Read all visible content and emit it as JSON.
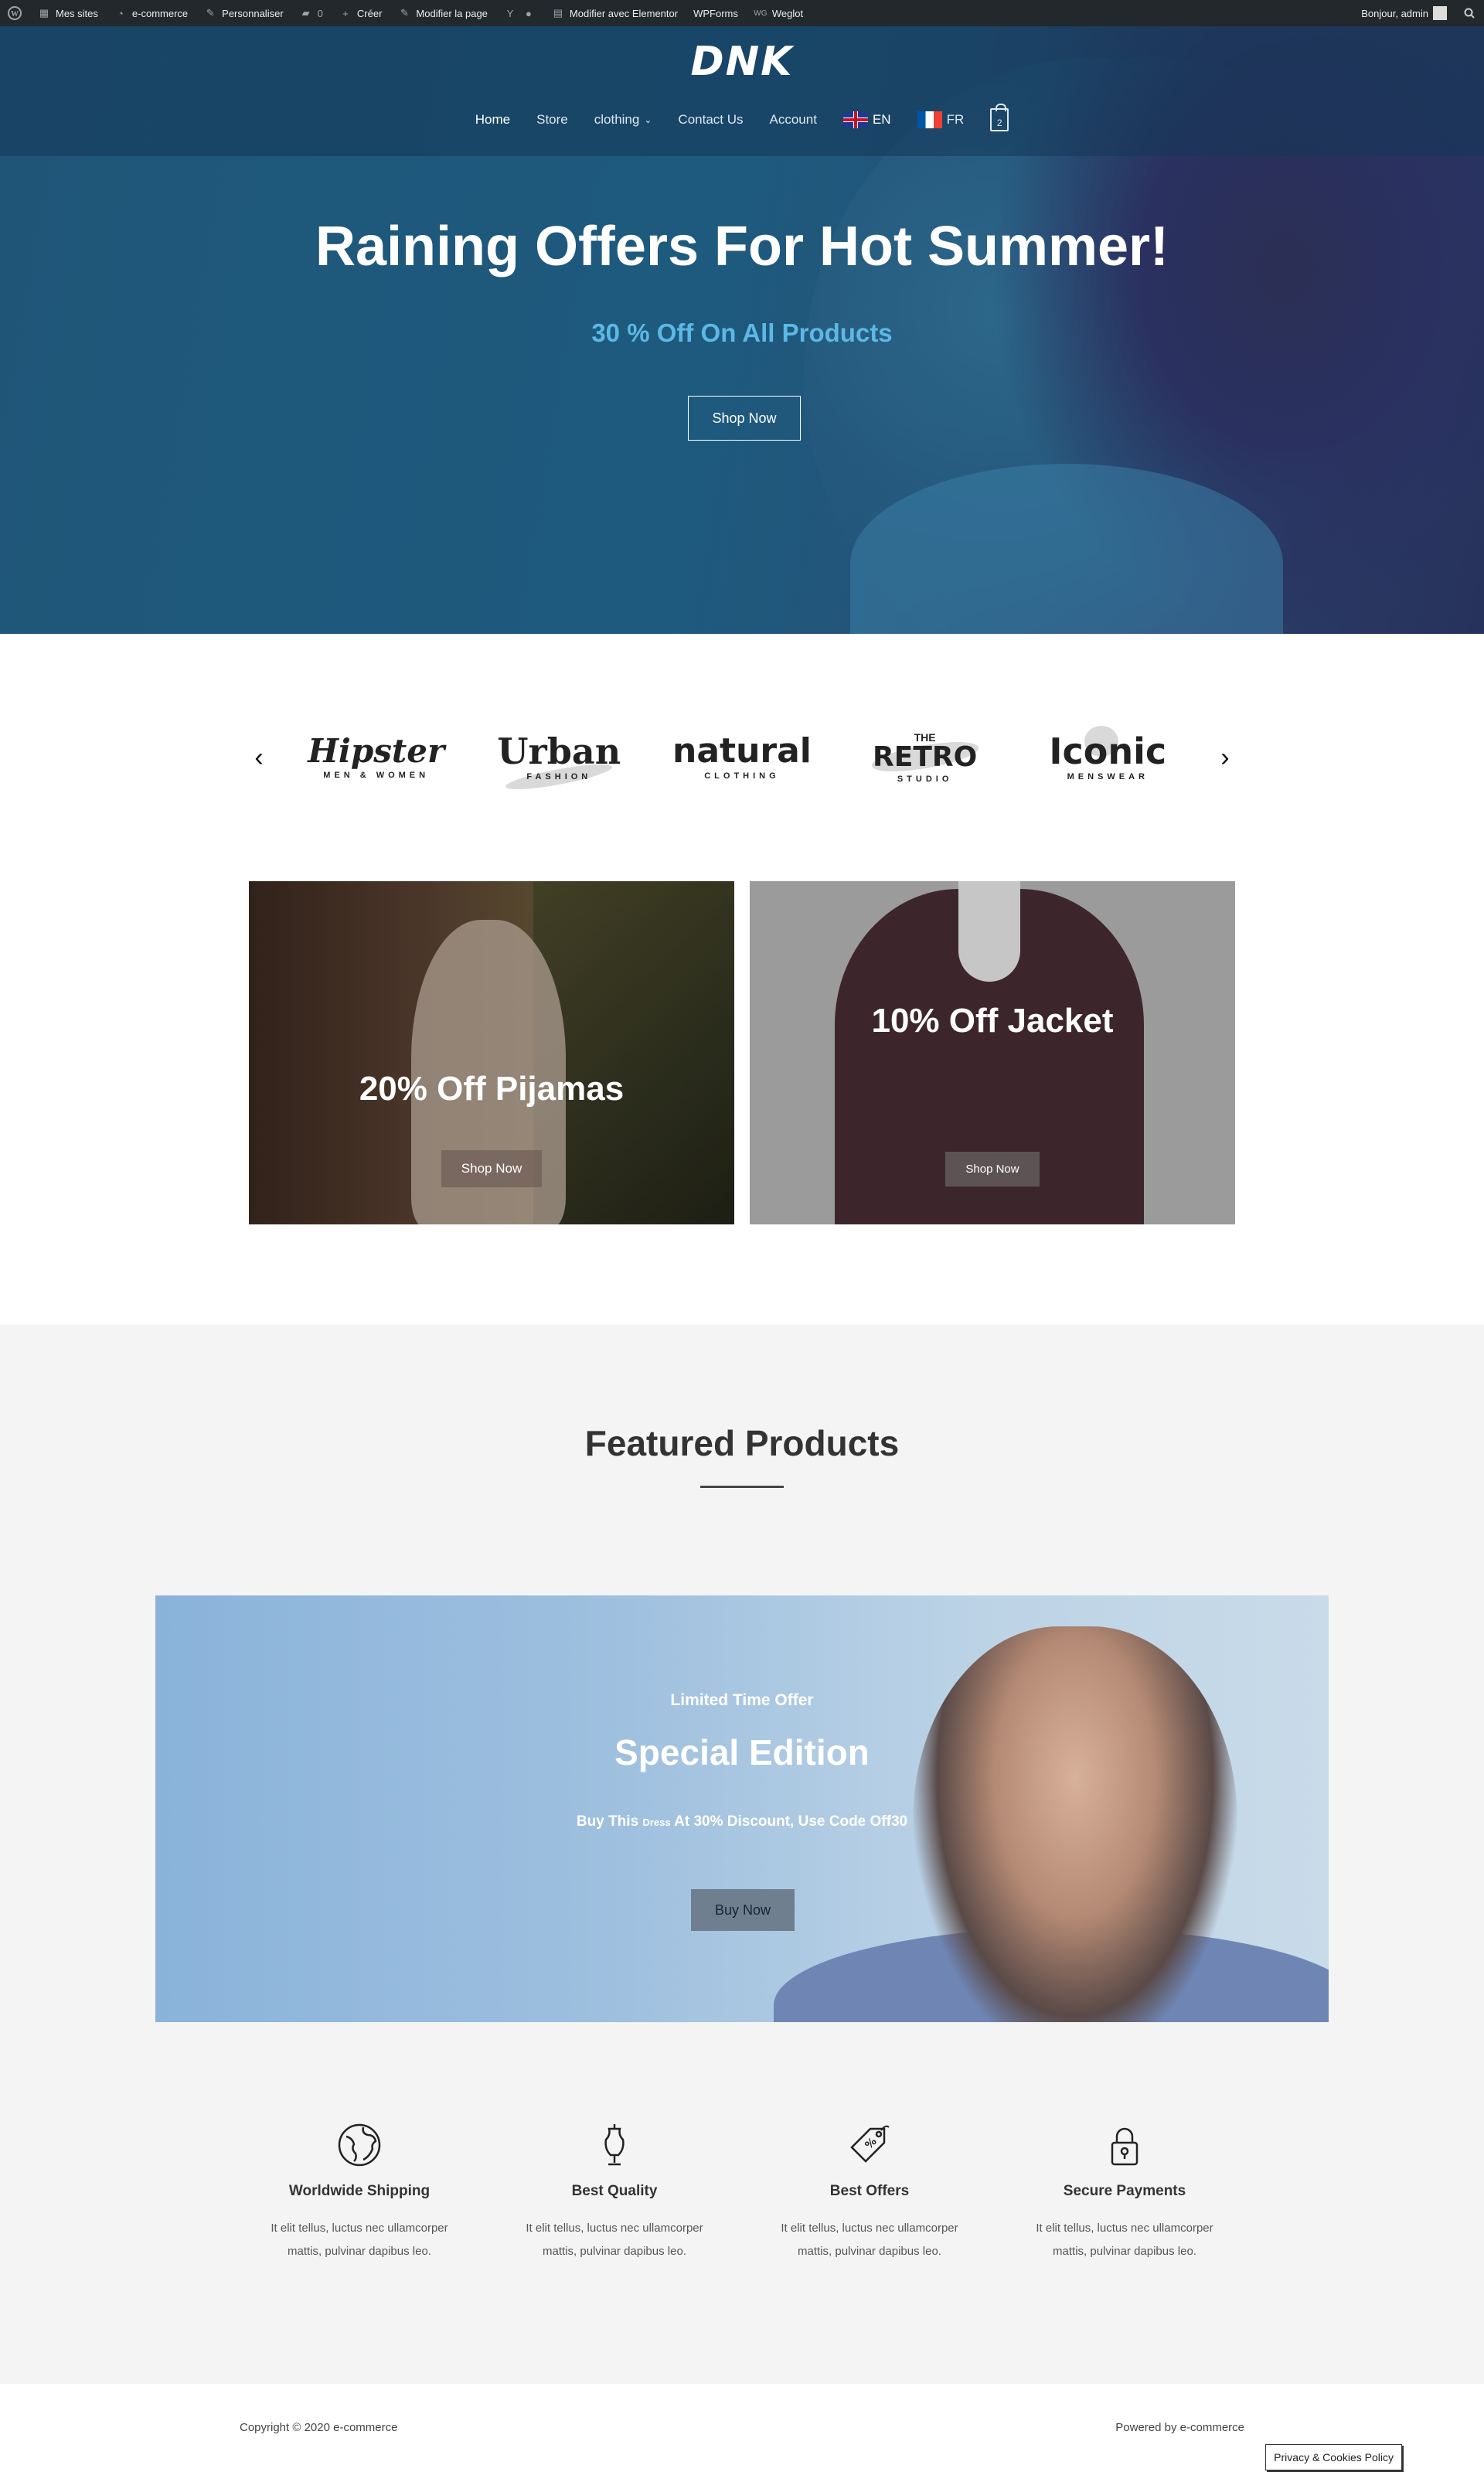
{
  "adminbar": {
    "my_sites": "Mes sites",
    "site_name": "e-commerce",
    "customize": "Personnaliser",
    "comments_count": "0",
    "new": "Créer",
    "edit_page": "Modifier la page",
    "edit_elementor": "Modifier avec Elementor",
    "wpforms": "WPForms",
    "weglot": "Weglot",
    "greeting": "Bonjour, admin"
  },
  "header": {
    "logo": "DNK",
    "nav": [
      "Home",
      "Store",
      "clothing",
      "Contact Us",
      "Account"
    ],
    "lang_en": "EN",
    "lang_fr": "FR",
    "cart_count": "2"
  },
  "hero": {
    "title": "Raining Offers For Hot Summer!",
    "subtitle": "30 % Off On All Products",
    "button": "Shop Now"
  },
  "brands": [
    {
      "name": "Hipster",
      "tag": "MEN & WOMEN"
    },
    {
      "name": "Urban",
      "tag": "FASHION"
    },
    {
      "name": "natural",
      "tag": "CLOTHING"
    },
    {
      "the": "THE",
      "name": "RETRO",
      "tag": "STUDIO"
    },
    {
      "name": "Iconic",
      "tag": "MENSWEAR"
    }
  ],
  "promos": [
    {
      "title": "20% Off Pijamas",
      "button": "Shop Now"
    },
    {
      "title": "10% Off Jacket",
      "button": "Shop Now"
    }
  ],
  "featured": {
    "title": "Featured Products"
  },
  "banner": {
    "small": "Limited Time Offer",
    "title": "Special Edition",
    "desc_before": "Buy This",
    "desc_dress": "Dress",
    "desc_after": "At 30% Discount, Use Code Off30",
    "button": "Buy Now"
  },
  "features": [
    {
      "title": "Worldwide Shipping",
      "text": "It elit tellus, luctus nec ullamcorper mattis, pulvinar dapibus leo.",
      "icon": "globe-icon"
    },
    {
      "title": "Best Quality",
      "text": "It elit tellus, luctus nec ullamcorper mattis, pulvinar dapibus leo.",
      "icon": "mannequin-icon"
    },
    {
      "title": "Best Offers",
      "text": "It elit tellus, luctus nec ullamcorper mattis, pulvinar dapibus leo.",
      "icon": "price-tag-icon"
    },
    {
      "title": "Secure Payments",
      "text": "It elit tellus, luctus nec ullamcorper mattis, pulvinar dapibus leo.",
      "icon": "lock-icon"
    }
  ],
  "footer": {
    "copyright": "Copyright © 2020 e-commerce",
    "powered": "Powered by e-commerce",
    "cookie": "Privacy & Cookies Policy"
  }
}
